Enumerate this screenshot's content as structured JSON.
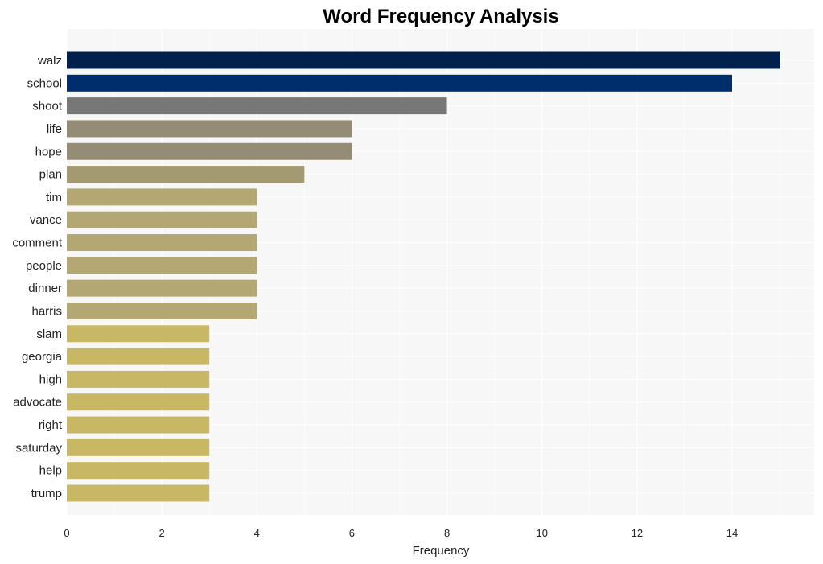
{
  "chart_data": {
    "type": "bar",
    "orientation": "horizontal",
    "title": "Word Frequency Analysis",
    "xlabel": "Frequency",
    "ylabel": "",
    "xlim": [
      0,
      15.7
    ],
    "xticks": [
      0,
      2,
      4,
      6,
      8,
      10,
      12,
      14
    ],
    "grid": true,
    "categories": [
      "walz",
      "school",
      "shoot",
      "life",
      "hope",
      "plan",
      "tim",
      "vance",
      "comment",
      "people",
      "dinner",
      "harris",
      "slam",
      "georgia",
      "high",
      "advocate",
      "right",
      "saturday",
      "help",
      "trump"
    ],
    "values": [
      15,
      14,
      8,
      6,
      6,
      5,
      4,
      4,
      4,
      4,
      4,
      4,
      3,
      3,
      3,
      3,
      3,
      3,
      3,
      3
    ],
    "colors": [
      "#00214d",
      "#002d6b",
      "#777777",
      "#948c74",
      "#948c74",
      "#a39a72",
      "#b3a873",
      "#b3a873",
      "#b3a873",
      "#b3a873",
      "#b3a873",
      "#b3a873",
      "#c8b866",
      "#c8b866",
      "#c8b866",
      "#c8b866",
      "#c8b866",
      "#c8b866",
      "#c8b866",
      "#c8b866"
    ],
    "plot_background": "#f7f7f7"
  }
}
